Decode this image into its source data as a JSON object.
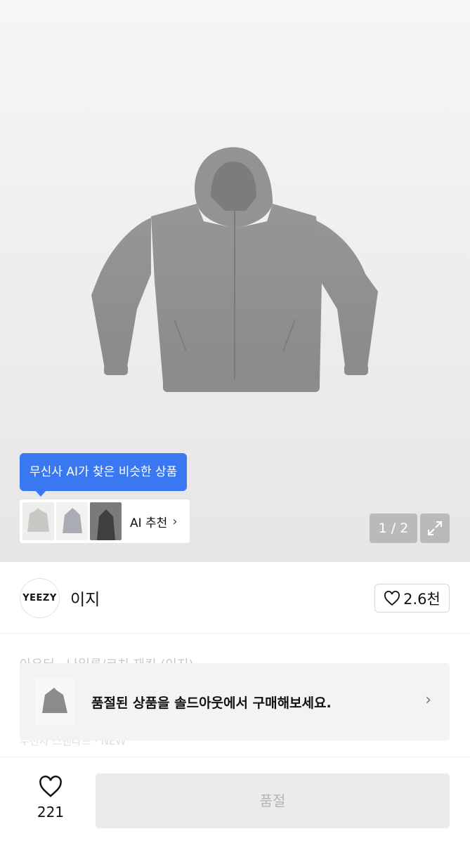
{
  "gallery": {
    "ai_tooltip": "무신사 AI가 찾은 비슷한 상품",
    "ai_reco_label": "AI 추천",
    "page_indicator": "1 / 2"
  },
  "brand": {
    "logo_text": "YEEZY",
    "name": "이지",
    "likes": "2.6천"
  },
  "background_text": {
    "line1": "아우터 · 나일론/코치 재킷 (이지)",
    "line2": "무진사 스탠다드 · NEW"
  },
  "soldout_banner": {
    "text": "품절된 상품을 솔드아웃에서 구매해보세요."
  },
  "bottom_bar": {
    "wish_count": "221",
    "buy_label": "품절"
  },
  "colors": {
    "accent_blue": "#3a78f2",
    "product_gray": "#8f8f8f",
    "disabled_bg": "#ebebeb"
  }
}
